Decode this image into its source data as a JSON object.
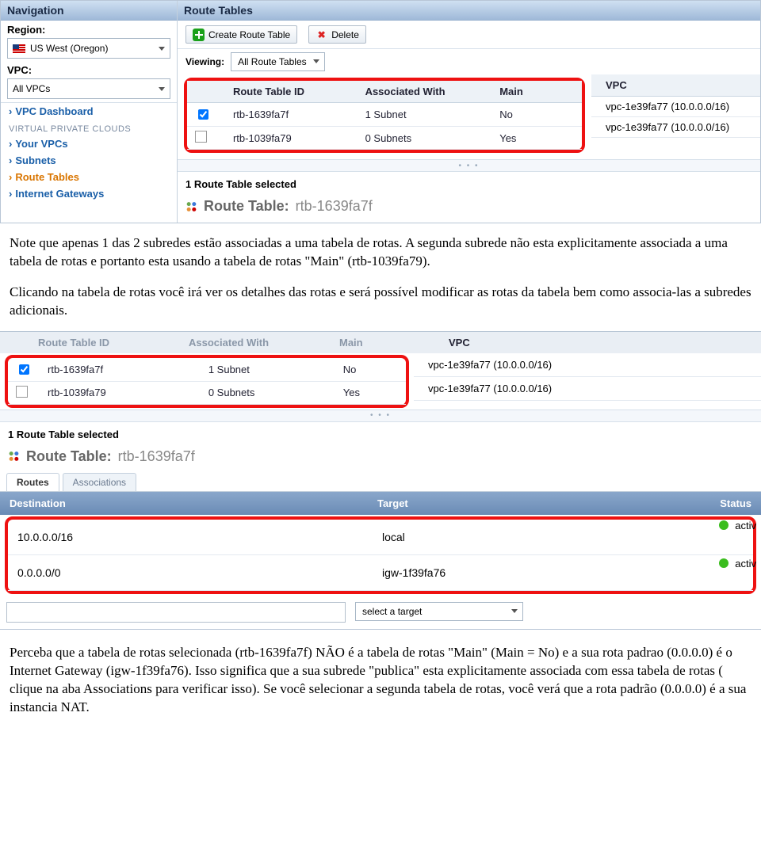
{
  "nav": {
    "title": "Navigation",
    "region_label": "Region:",
    "region_value": "US West (Oregon)",
    "vpc_label": "VPC:",
    "vpc_value": "All VPCs",
    "dashboard": "VPC Dashboard",
    "section": "VIRTUAL PRIVATE CLOUDS",
    "links": [
      "Your VPCs",
      "Subnets",
      "Route Tables",
      "Internet Gateways"
    ]
  },
  "main": {
    "title": "Route Tables",
    "btn_create": "Create Route Table",
    "btn_delete": "Delete",
    "viewing_label": "Viewing:",
    "viewing_value": "All Route Tables",
    "cols": [
      "Route Table ID",
      "Associated With",
      "Main"
    ],
    "vpc_col": "VPC",
    "rows": [
      {
        "checked": true,
        "id": "rtb-1639fa7f",
        "assoc": "1 Subnet",
        "main": "No",
        "vpc": "vpc-1e39fa77 (10.0.0.0/16)"
      },
      {
        "checked": false,
        "id": "rtb-1039fa79",
        "assoc": "0 Subnets",
        "main": "Yes",
        "vpc": "vpc-1e39fa77 (10.0.0.0/16)"
      }
    ],
    "sel_header": "1 Route Table selected",
    "rt_label": "Route Table:",
    "rt_id": "rtb-1639fa7f"
  },
  "doc": {
    "p1": "Note que apenas 1 das 2 subredes estão associadas a uma tabela de rotas. A segunda subrede não esta explicitamente associada a uma tabela de rotas e portanto esta usando a tabela de rotas \"Main\" (rtb-1039fa79).",
    "p2": "Clicando na tabela de rotas você irá ver os detalhes das rotas e será possível modificar as rotas da tabela bem como associa-las a subredes adicionais.",
    "p3": "Perceba que a tabela de rotas selecionada (rtb-1639fa7f) NÃO é a tabela de rotas \"Main\" (Main = No) e a sua rota padrao (0.0.0.0) é o  Internet Gateway (igw-1f39fa76). Isso significa que a sua subrede \"publica\" esta explicitamente associada com essa tabela de rotas ( clique na aba Associations para verificar isso).  Se você selecionar a segunda tabela de rotas, você verá que a rota padrão (0.0.0.0) é a sua instancia NAT."
  },
  "shot2": {
    "cols": [
      "Route Table ID",
      "Associated With",
      "Main"
    ],
    "vpc_col": "VPC",
    "rows": [
      {
        "checked": true,
        "id": "rtb-1639fa7f",
        "assoc": "1 Subnet",
        "main": "No",
        "vpc": "vpc-1e39fa77 (10.0.0.0/16)"
      },
      {
        "checked": false,
        "id": "rtb-1039fa79",
        "assoc": "0 Subnets",
        "main": "Yes",
        "vpc": "vpc-1e39fa77 (10.0.0.0/16)"
      }
    ],
    "sel_header": "1 Route Table selected",
    "rt_label": "Route Table:",
    "rt_id": "rtb-1639fa7f",
    "tabs": [
      "Routes",
      "Associations"
    ],
    "route_cols": [
      "Destination",
      "Target",
      "Status"
    ],
    "routes": [
      {
        "dest": "10.0.0.0/16",
        "target": "local",
        "status": "activ"
      },
      {
        "dest": "0.0.0.0/0",
        "target": "igw-1f39fa76",
        "status": "activ"
      }
    ],
    "target_placeholder": "select a target"
  }
}
